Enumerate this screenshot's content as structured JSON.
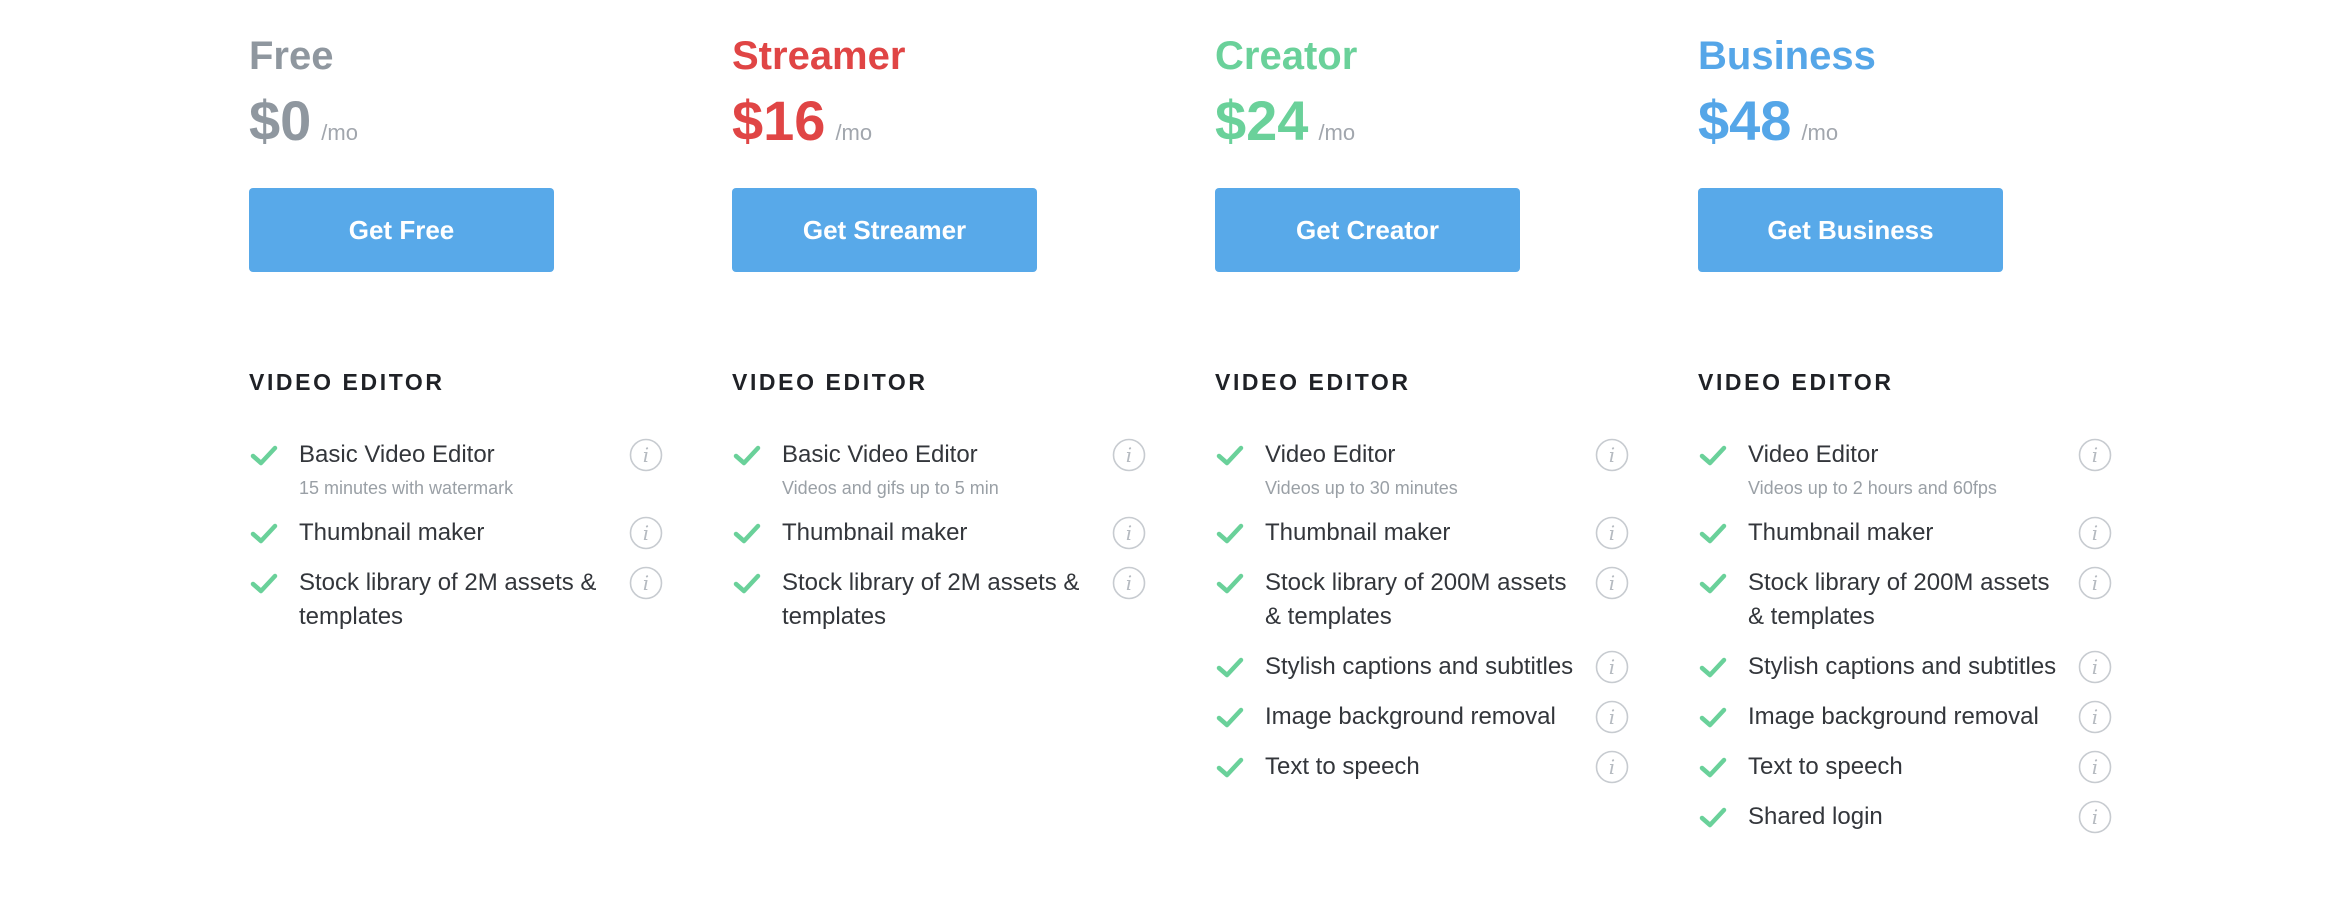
{
  "per_label": "/mo",
  "section_title": "VIDEO EDITOR",
  "colors": {
    "free": "#8f979f",
    "streamer": "#e04545",
    "creator": "#6ad19a",
    "business": "#55a6e8",
    "button": "#58a9e9",
    "check": "#6ad19a"
  },
  "plans": [
    {
      "name": "Free",
      "price": "$0",
      "cta": "Get Free",
      "features": [
        {
          "label": "Basic Video Editor",
          "sub": "15 minutes with watermark"
        },
        {
          "label": "Thumbnail maker"
        },
        {
          "label": "Stock library of 2M assets & templates"
        }
      ]
    },
    {
      "name": "Streamer",
      "price": "$16",
      "cta": "Get Streamer",
      "features": [
        {
          "label": "Basic Video Editor",
          "sub": "Videos and gifs up to 5 min"
        },
        {
          "label": "Thumbnail maker"
        },
        {
          "label": "Stock library of 2M assets & templates"
        }
      ]
    },
    {
      "name": "Creator",
      "price": "$24",
      "cta": "Get Creator",
      "features": [
        {
          "label": "Video Editor",
          "sub": "Videos up to 30 minutes"
        },
        {
          "label": "Thumbnail maker"
        },
        {
          "label": "Stock library of 200M assets & templates"
        },
        {
          "label": "Stylish captions and subtitles"
        },
        {
          "label": "Image background removal"
        },
        {
          "label": "Text to speech"
        }
      ]
    },
    {
      "name": "Business",
      "price": "$48",
      "cta": "Get Business",
      "features": [
        {
          "label": "Video Editor",
          "sub": "Videos up to 2 hours and 60fps"
        },
        {
          "label": "Thumbnail maker"
        },
        {
          "label": "Stock library of 200M assets & templates"
        },
        {
          "label": "Stylish captions and subtitles"
        },
        {
          "label": "Image background removal"
        },
        {
          "label": "Text to speech"
        },
        {
          "label": "Shared login"
        }
      ]
    }
  ]
}
